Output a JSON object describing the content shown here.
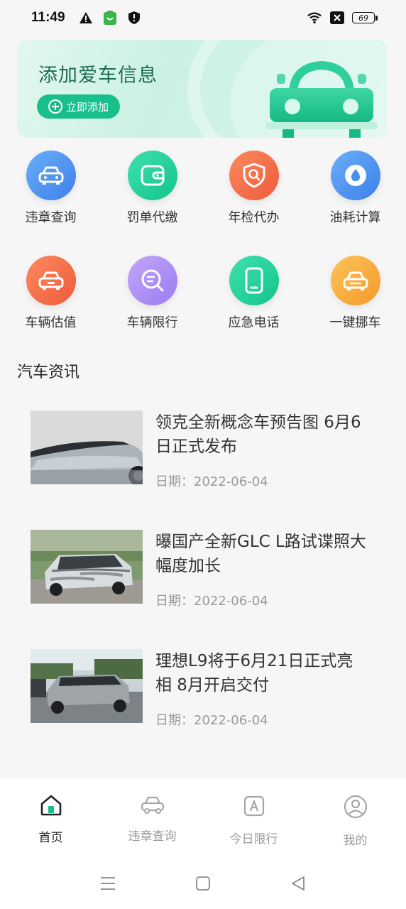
{
  "status": {
    "time": "11:49",
    "battery": "69"
  },
  "banner": {
    "title": "添加爱车信息",
    "button": "立即添加"
  },
  "grid": [
    {
      "label": "违章查询",
      "icon": "car-icon",
      "color": "#4a8ff0"
    },
    {
      "label": "罚单代缴",
      "icon": "wallet-icon",
      "color": "#1fc996"
    },
    {
      "label": "年检代办",
      "icon": "shield-search-icon",
      "color": "#f46a47"
    },
    {
      "label": "油耗计算",
      "icon": "drop-icon",
      "color": "#4a8ff0"
    },
    {
      "label": "车辆估值",
      "icon": "car-value-icon",
      "color": "#f46a47"
    },
    {
      "label": "车辆限行",
      "icon": "search-chat-icon",
      "color": "#a78af0"
    },
    {
      "label": "应急电话",
      "icon": "phone-icon",
      "color": "#1fc996"
    },
    {
      "label": "一键挪车",
      "icon": "car-move-icon",
      "color": "#f8a53a"
    }
  ],
  "news_section": {
    "title": "汽车资讯"
  },
  "news": [
    {
      "title": "领克全新概念车预告图 6月6日正式发布",
      "date_label": "日期：",
      "date": "2022-06-04"
    },
    {
      "title": "曝国产全新GLC L路试谍照大幅度加长",
      "date_label": "日期：",
      "date": "2022-06-04"
    },
    {
      "title": "理想L9将于6月21日正式亮相 8月开启交付",
      "date_label": "日期：",
      "date": "2022-06-04"
    }
  ],
  "nav": [
    {
      "label": "首页",
      "icon": "home-icon"
    },
    {
      "label": "违章查询",
      "icon": "car-outline-icon"
    },
    {
      "label": "今日限行",
      "icon": "road-sign-icon"
    },
    {
      "label": "我的",
      "icon": "user-icon"
    }
  ]
}
